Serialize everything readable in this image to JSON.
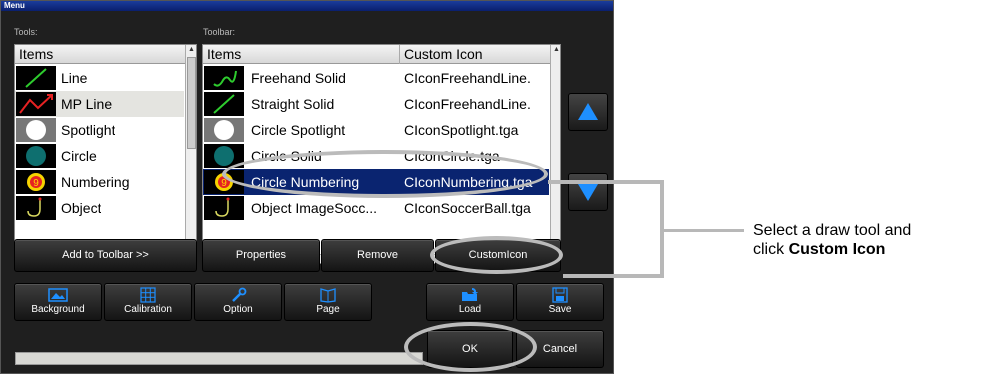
{
  "window": {
    "title": "Menu"
  },
  "tools": {
    "label": "Tools:",
    "header": "Items",
    "items": [
      {
        "label": "Line",
        "icon": "green-line-icon"
      },
      {
        "label": "MP Line",
        "icon": "red-zigzag-icon"
      },
      {
        "label": "Spotlight",
        "icon": "white-circle-icon"
      },
      {
        "label": "Circle",
        "icon": "teal-circle-icon"
      },
      {
        "label": "Numbering",
        "icon": "number-nine-icon"
      },
      {
        "label": "Object",
        "icon": "hook-icon"
      }
    ],
    "add_button": "Add to Toolbar >>"
  },
  "toolbar": {
    "label": "Toolbar:",
    "headers": [
      "Items",
      "Custom Icon"
    ],
    "rows": [
      {
        "item": "Freehand Solid",
        "icon_file": "CIconFreehandLine.",
        "icon": "freehand-curve-icon"
      },
      {
        "item": "Straight Solid",
        "icon_file": "CIconFreehandLine.",
        "icon": "green-line-icon"
      },
      {
        "item": "Circle Spotlight",
        "icon_file": "CIconSpotlight.tga",
        "icon": "white-circle-icon"
      },
      {
        "item": "Circle Solid",
        "icon_file": "CIconCircle.tga",
        "icon": "teal-circle-icon"
      },
      {
        "item": "Circle Numbering",
        "icon_file": "CIconNumbering.tga",
        "icon": "number-nine-icon"
      },
      {
        "item": "Object ImageSocc...",
        "icon_file": "CIconSoccerBall.tga",
        "icon": "hook-icon"
      }
    ],
    "selected_index": 4,
    "buttons": {
      "properties": "Properties",
      "remove": "Remove",
      "custom_icon": "CustomIcon"
    }
  },
  "bottom_buttons": {
    "background": "Background",
    "calibration": "Calibration",
    "option": "Option",
    "page": "Page",
    "load": "Load",
    "save": "Save",
    "ok": "OK",
    "cancel": "Cancel"
  },
  "callout": {
    "line1": "Select a draw tool and",
    "line2_prefix": "click ",
    "line2_bold": "Custom Icon"
  },
  "colors": {
    "selection": "#0a2470",
    "accent_blue": "#1e8fff",
    "window_bg": "#1f1f1f"
  }
}
